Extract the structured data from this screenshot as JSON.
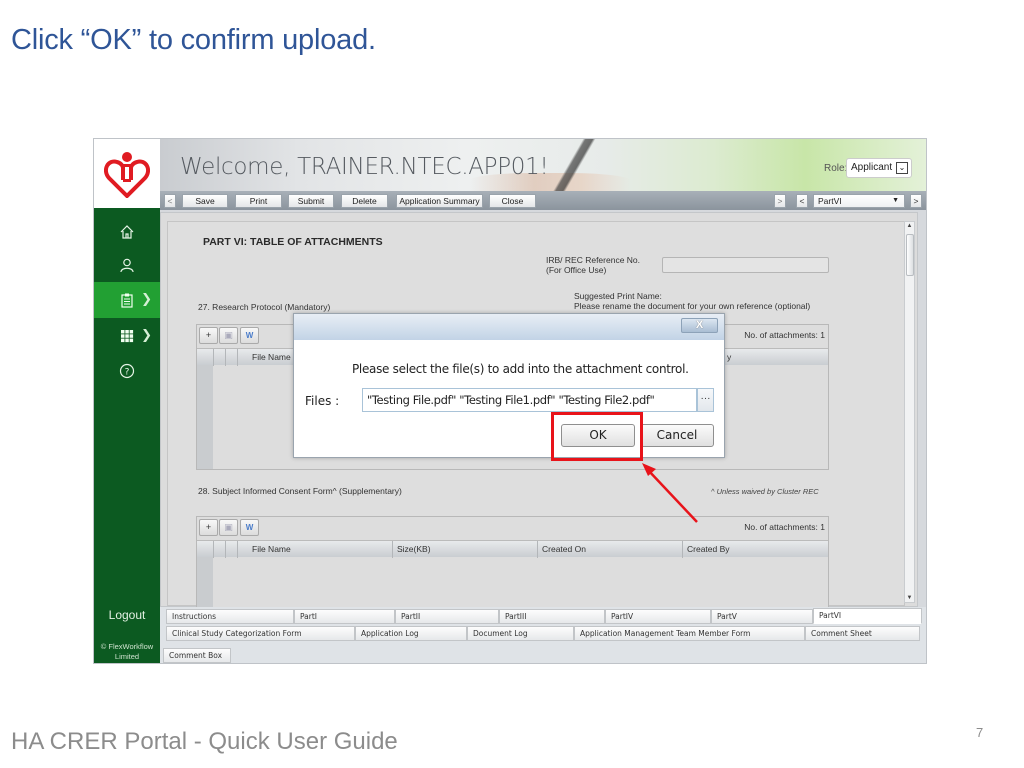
{
  "slide": {
    "title": "Click “OK” to confirm upload.",
    "footer": "HA CRER Portal - Quick User Guide",
    "page_number": "7"
  },
  "app": {
    "welcome": "Welcome, TRAINER.NTEC.APP01!",
    "role_label": "Role:",
    "role_value": "Applicant",
    "toolbar": {
      "prev": "<",
      "buttons": [
        "Save",
        "Print",
        "Submit",
        "Delete",
        "Application Summary",
        "Close"
      ],
      "nav_next_disabled": ">",
      "nav_prev": "<",
      "part_select": "PartVI",
      "nav_next": ">"
    },
    "sidebar": {
      "items": [
        {
          "icon": "home-icon"
        },
        {
          "icon": "user-icon"
        },
        {
          "icon": "clipboard-icon",
          "active": true,
          "has_submenu": true
        },
        {
          "icon": "grid-icon",
          "has_submenu": true
        },
        {
          "icon": "help-icon"
        }
      ],
      "logout": "Logout",
      "copyright_line1": "© FlexWorkflow",
      "copyright_line2": "Limited"
    },
    "form": {
      "heading": "PART VI:  TABLE OF ATTACHMENTS",
      "irb_label_1": "IRB/ REC Reference No.",
      "irb_label_2": "(For Office Use)",
      "irb_value": "",
      "suggested_1": "Suggested Print Name:",
      "suggested_2": "Please rename the document for your own reference (optional)",
      "section27": "27. Research Protocol (Mandatory)",
      "section28": "28. Subject Informed Consent Form^ (Supplementary)",
      "note28": "^ Unless waived by Cluster REC",
      "grid27": {
        "count": "No. of attachments: 1",
        "columns": [
          "File Name",
          "",
          "",
          "y"
        ]
      },
      "grid28": {
        "count": "No. of attachments: 1",
        "columns": [
          "File Name",
          "Size(KB)",
          "Created On",
          "Created By"
        ]
      },
      "grid_tools": {
        "add": "+",
        "save": "💾",
        "open": "W"
      }
    },
    "tabs_row1": [
      "Instructions",
      "PartI",
      "PartII",
      "PartIII",
      "PartIV",
      "PartV",
      "PartVI"
    ],
    "tabs_row1_active": "PartVI",
    "tabs_row2": [
      "Clinical Study Categorization Form",
      "Application Log",
      "Document Log",
      "Application Management Team Member Form",
      "Comment Sheet"
    ],
    "tabs_row3": [
      "Comment Box"
    ]
  },
  "dialog": {
    "close": "X",
    "message": "Please select the file(s) to add into the attachment control.",
    "files_label": "Files :",
    "files_value": "\"Testing File.pdf\" \"Testing File1.pdf\" \"Testing File2.pdf\"",
    "browse": "···",
    "ok": "OK",
    "cancel": "Cancel"
  },
  "annotation": {
    "highlight_color": "#e8131a"
  }
}
